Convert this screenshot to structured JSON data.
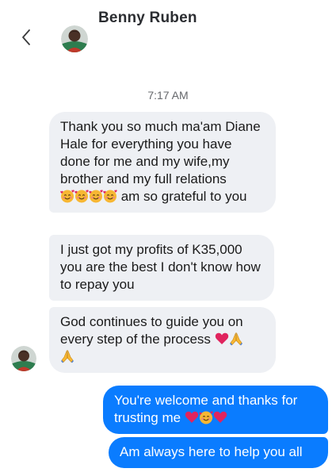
{
  "header": {
    "contact_name": "Benny Ruben",
    "back_icon": "chevron-left-icon"
  },
  "conversation": {
    "timestamp": "7:17 AM",
    "incoming": [
      {
        "text_before": "Thank you so much ma'am Diane Hale for everything you have done for me and my wife,my brother and my full relations ",
        "emojis": [
          "smiling-face-with-hearts",
          "smiling-face-with-hearts",
          "smiling-face-with-hearts",
          "smiling-face-with-hearts"
        ],
        "text_after": " am so grateful to you"
      },
      {
        "text": "I just got my profits of K35,000 you are the best I don't know how to repay you"
      },
      {
        "text_before": "God continues to guide you on every step of the process ",
        "emojis": [
          "red-heart",
          "folded-hands",
          "folded-hands"
        ]
      }
    ],
    "outgoing": [
      {
        "text_before": "You're welcome and thanks for trusting me ",
        "emojis": [
          "red-heart",
          "smiling-face-with-hearts",
          "red-heart"
        ]
      },
      {
        "text": "Am always here to help you all"
      }
    ]
  },
  "colors": {
    "outgoing_bubble": "#0a7cff",
    "incoming_bubble": "#eef0f4",
    "timestamp": "#65676b"
  }
}
